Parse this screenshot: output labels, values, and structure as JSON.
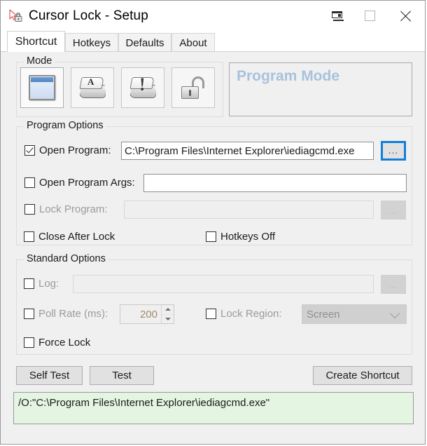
{
  "window": {
    "title": "Cursor Lock - Setup",
    "app_icon": "cursor-lock-icon",
    "minimize_label": "",
    "maximize_label": "",
    "close_label": ""
  },
  "tabs": [
    {
      "label": "Shortcut",
      "active": true
    },
    {
      "label": "Hotkeys",
      "active": false
    },
    {
      "label": "Defaults",
      "active": false
    },
    {
      "label": "About",
      "active": false
    }
  ],
  "mode": {
    "group_title": "Mode",
    "buttons": [
      {
        "icon": "program-window-icon",
        "selected": true
      },
      {
        "icon": "keyboard-key-a-icon",
        "selected": false
      },
      {
        "icon": "keyboard-key-exclamation-icon",
        "selected": false
      },
      {
        "icon": "unlocked-padlock-icon",
        "selected": false
      }
    ],
    "label": "Program Mode"
  },
  "program_options": {
    "group_title": "Program Options",
    "open_program": {
      "label": "Open Program:",
      "checked": true,
      "value": "C:\\Program Files\\Internet Explorer\\iediagcmd.exe",
      "browse_label": "...",
      "browse_focused": true,
      "disabled": false
    },
    "open_program_args": {
      "label": "Open Program Args:",
      "checked": false,
      "value": "",
      "disabled": false
    },
    "lock_program": {
      "label": "Lock Program:",
      "checked": false,
      "value": "",
      "browse_label": "...",
      "disabled": true
    },
    "close_after_lock": {
      "label": "Close After Lock",
      "checked": false
    },
    "hotkeys_off": {
      "label": "Hotkeys Off",
      "checked": false
    }
  },
  "standard_options": {
    "group_title": "Standard Options",
    "log": {
      "label": "Log:",
      "checked": false,
      "value": "",
      "browse_label": "...",
      "disabled": true
    },
    "poll_rate": {
      "label": "Poll Rate (ms):",
      "checked": false,
      "value": "200",
      "disabled": true
    },
    "lock_region": {
      "label": "Lock Region:",
      "checked": false,
      "value": "Screen",
      "disabled": true
    },
    "force_lock": {
      "label": "Force Lock",
      "checked": false
    }
  },
  "actions": {
    "self_test": "Self Test",
    "test": "Test",
    "create_shortcut": "Create Shortcut"
  },
  "command_preview": "/O:\"C:\\Program Files\\Internet Explorer\\iediagcmd.exe\"",
  "colors": {
    "accent_focus": "#0f7fdb",
    "mode_label": "#a8c2dd",
    "command_bg": "#e4f5e2",
    "window_bg": "#f0f0f0"
  }
}
